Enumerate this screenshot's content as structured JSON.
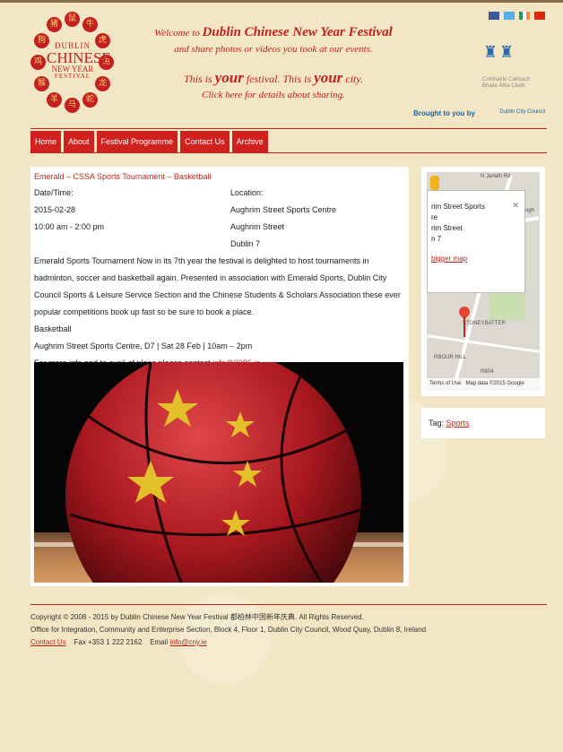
{
  "header": {
    "logo": {
      "zodiac": [
        "猪",
        "鼠",
        "牛",
        "虎",
        "兔",
        "龙",
        "蛇",
        "马",
        "羊",
        "猴",
        "鸡",
        "狗"
      ],
      "line1": "DUBLIN",
      "line2": "CHINESE",
      "line3": "NEW YEAR",
      "line4": "FESTIVAL"
    },
    "welcome_prefix": "Welcome to ",
    "welcome_name": "Dublin Chinese New Year Festival",
    "share_line": "and share photos or videos you took at our events.",
    "your_festival_a": "This is ",
    "your_word": "your",
    "your_festival_b": " festival. This is ",
    "your_word2": "your",
    "your_festival_c": " city.",
    "click_here": "Click here for details about sharing.",
    "council_name": "Comhairle Cathrach Bhaile Átha Cliath",
    "brought_by": "Brought to you by",
    "council_short": "Dublin City Council"
  },
  "nav": {
    "items": [
      "Home",
      "About",
      "Festival Programme",
      "Contact Us",
      "Archive"
    ]
  },
  "post": {
    "title": "Emerald – CSSA Sports Tournament – Basketball",
    "date_label": "Date/Time:",
    "date": "2015-02-28",
    "time": "10:00 am - 2:00 pm",
    "location_label": "Location:",
    "location_name": "Aughrim Street Sports Centre",
    "location_street": "Aughrim Street",
    "location_city": "Dublin 7",
    "body": "Emerald Sports Tournament Now in its 7th year the festival is delighted to host tournaments in badminton, soccer and basketball again. Presented in association with Emerald Sports, Dublin City Council Sports & Leisure Service Section and the Chinese Students & Scholars Association these ever popular competitions book up fast so be sure to book a place.",
    "sport": "Basketball",
    "venue_line": "Aughrim Street Sports Centre, D7 | Sat 28 Feb | 10am – 2pm",
    "contact_prefix": "For more info and to avail of place please contact ",
    "contact_email": "info@0086.ie"
  },
  "map": {
    "popup_line1": "rim Street Sports",
    "popup_line2": "re",
    "popup_line3": "rim Street",
    "popup_line4": "n 7",
    "bigger_map": "bigger map",
    "close": "✕",
    "label_stoneybatter": "STONEYBATTER",
    "label_arbour": "RBOUR HILL",
    "label_street1": "N Jarlath Rd",
    "label_street2": "nnaugh",
    "label_r804": "R804",
    "terms": "Terms of Use",
    "mapdata": "Map data ©2015 Google"
  },
  "tag": {
    "label": "Tag: ",
    "value": "Sports"
  },
  "footer": {
    "copyright": "Copyright © 2008 - 2015 by Dublin Chinese New Year Festival 都柏林中国新年庆典. All Rights Reserved.",
    "office": "Office for Integration, Community and Enterprise Section, Block 4, Floor 1, Dublin City Council, Wood Quay, Dublin 8, Ireland",
    "contact_link": "Contact Us",
    "fax": "Fax +353 1 222 2162",
    "email_label": "Email ",
    "email": "info@cny.ie"
  },
  "colors": {
    "accent": "#c4201f",
    "nav_bg": "#d0211f",
    "background": "#f3e6c4",
    "link": "#b8291c"
  }
}
